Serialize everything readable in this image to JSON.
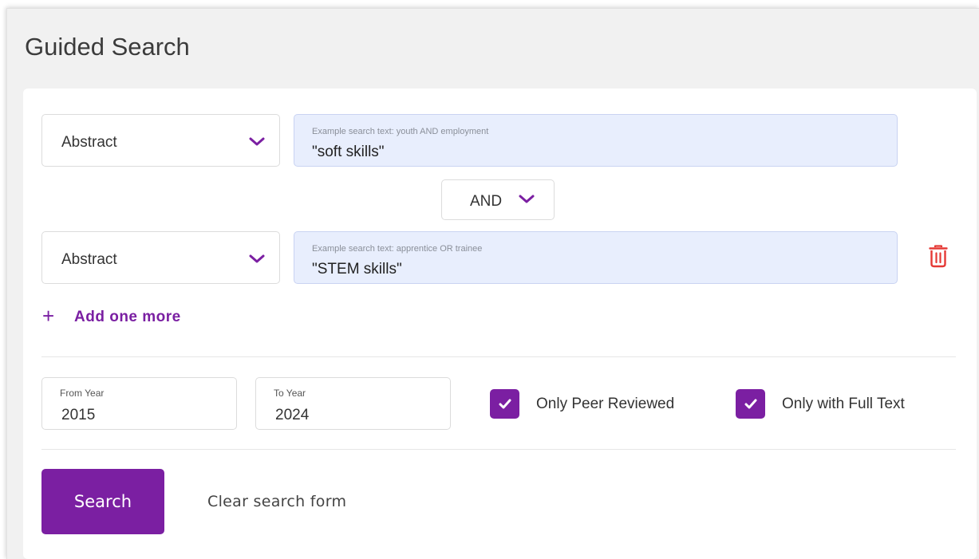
{
  "page": {
    "title": "Guided Search"
  },
  "rows": [
    {
      "field": "Abstract",
      "placeholder": "Example search text: youth AND employment",
      "value": "\"soft skills\""
    },
    {
      "field": "Abstract",
      "placeholder": "Example search text: apprentice OR trainee",
      "value": "\"STEM skills\""
    }
  ],
  "operator": "AND",
  "add_more": {
    "plus": "+",
    "label": "Add one more"
  },
  "years": {
    "from_label": "From Year",
    "from_value": "2015",
    "to_label": "To Year",
    "to_value": "2024"
  },
  "filters": {
    "peer_reviewed": {
      "label": "Only Peer Reviewed",
      "checked": true
    },
    "full_text": {
      "label": "Only with Full Text",
      "checked": true
    }
  },
  "actions": {
    "search_label": "Search",
    "clear_label": "Clear search form"
  },
  "colors": {
    "accent": "#7b1fa2",
    "input_bg": "#e8eefd",
    "delete": "#e53935"
  },
  "icons": {
    "dropdown": "chevron-down-icon",
    "delete": "trash-icon",
    "add": "plus-icon",
    "check": "check-icon"
  }
}
